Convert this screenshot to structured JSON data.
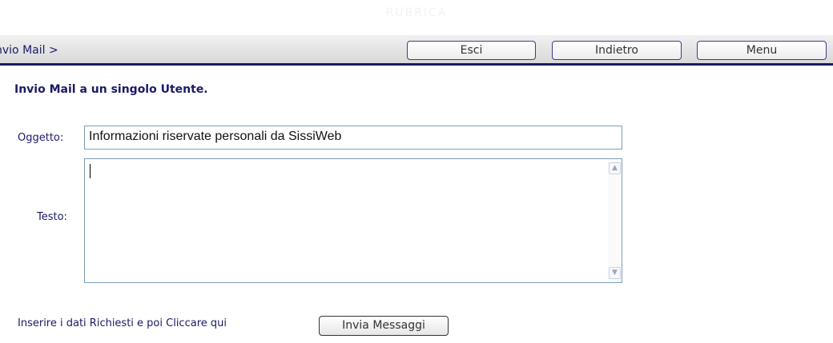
{
  "header": {
    "top_title": "RUBRICA"
  },
  "toolbar": {
    "breadcrumb": "nvio Mail >",
    "esci_label": "Esci",
    "indietro_label": "Indietro",
    "menu_label": "Menu"
  },
  "form": {
    "heading": "Invio Mail a un singolo Utente.",
    "subject_label": "Oggetto:",
    "subject_value": "Informazioni riservate personali da SissiWeb",
    "body_label": "Testo:",
    "body_value": "",
    "instruction": "Inserire i dati Richiesti e poi Cliccare qui",
    "send_label": "Invia Messaggi"
  },
  "colors": {
    "accent_navy": "#1b1d5c",
    "label_text": "#1a1a66",
    "input_border": "#7f9db9"
  }
}
